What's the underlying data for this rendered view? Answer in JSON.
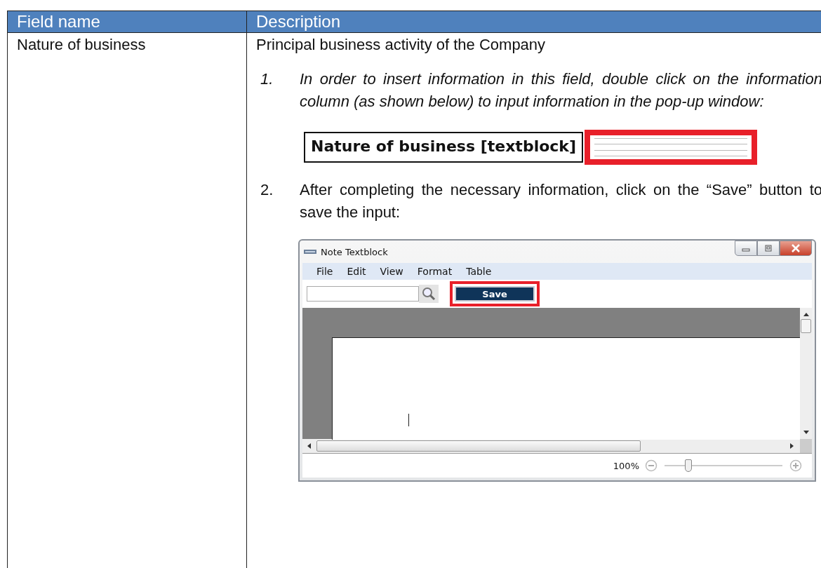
{
  "table": {
    "columns": [
      "Field name",
      "Description"
    ],
    "rows": [
      {
        "field_name": "Nature of business",
        "description": "Principal business activity of the Company",
        "steps": [
          {
            "number": "1.",
            "kind": "italic",
            "text": "In order to insert information in this field, double click on the information column (as shown below) to input information in the pop-up window:",
            "figure": {
              "kind": "field",
              "label": "Nature of business [textblock]",
              "highlighted": true
            }
          },
          {
            "number": "2.",
            "kind": "plain",
            "text": "After completing the necessary information, click on the “Save” button to save the input:",
            "figure": {
              "kind": "window",
              "title": "Note Textblock",
              "menu": [
                "File",
                "Edit",
                "View",
                "Format",
                "Table"
              ],
              "save_button": {
                "label": "Save",
                "highlighted": true
              },
              "zoom": {
                "reading": "100%",
                "level": 0.2
              }
            }
          }
        ]
      }
    ]
  }
}
